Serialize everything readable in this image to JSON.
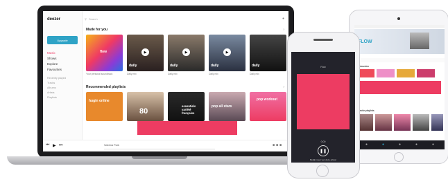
{
  "laptop": {
    "logo": "deezer",
    "sidebar_button": "Upgrade",
    "nav": [
      {
        "label": "Music",
        "active": true
      },
      {
        "label": "Shows",
        "active": false
      },
      {
        "label": "Explore",
        "active": false
      },
      {
        "label": "Favourites",
        "active": false
      }
    ],
    "nav_sub": [
      "Recently played",
      "Tracks",
      "Albums",
      "Artists",
      "Playlists"
    ],
    "search_placeholder": "Search",
    "made_for_you": {
      "title": "Made for you",
      "cards": [
        {
          "title": "flow",
          "caption": "Your personal soundtrack"
        },
        {
          "title": "daily",
          "caption": "Daily mix"
        },
        {
          "title": "daily",
          "caption": "Daily mix"
        },
        {
          "title": "daily",
          "caption": "Daily mix"
        },
        {
          "title": "daily",
          "caption": "Daily mix"
        }
      ]
    },
    "recommended": {
      "title": "Recommended playlists",
      "cards": [
        {
          "title": "hugin online"
        },
        {
          "title": "80"
        },
        {
          "title": "essentiels variété française"
        },
        {
          "title": "pop all stars"
        },
        {
          "title": "pop workout"
        }
      ]
    },
    "now_playing": "Sabrina Park"
  },
  "phone": {
    "top_label": "Flow",
    "time": "0:00",
    "button": "Bekijk meer van deze artiest"
  },
  "tablet": {
    "flow_label": "FLOW",
    "section1": "Aanbevolen",
    "section2": "Selectie playlists"
  },
  "colors": {
    "accent_pink": "#ed3c62",
    "deezer_blue": "#2fa3c6"
  }
}
